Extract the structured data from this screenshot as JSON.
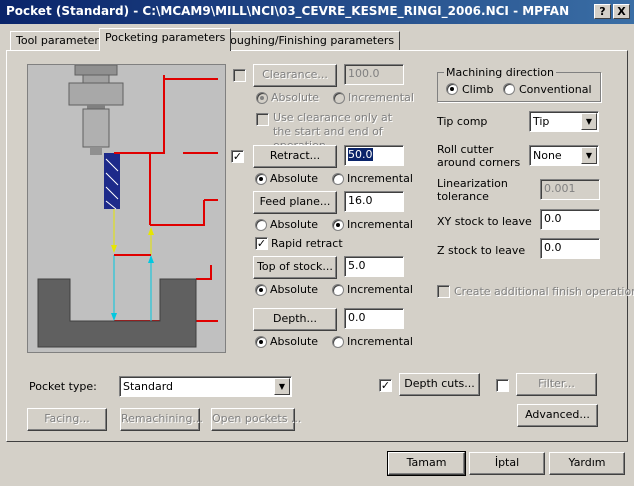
{
  "window": {
    "title": "Pocket (Standard) - C:\\MCAM9\\MILL\\NCI\\03_CEVRE_KESME_RINGI_2006.NCI - MPFAN",
    "help_btn": "?",
    "close_btn": "X"
  },
  "tabs": [
    {
      "label": "Tool parameters"
    },
    {
      "label": "Pocketing parameters"
    },
    {
      "label": "Roughing/Finishing parameters"
    }
  ],
  "clearance": {
    "label": "Clearance...",
    "value": "100.0",
    "note": "Use clearance only at the start and end of operation"
  },
  "retract": {
    "label": "Retract...",
    "value": "50.0"
  },
  "feed_plane": {
    "label": "Feed plane...",
    "value": "16.0"
  },
  "rapid_retract": "Rapid retract",
  "top_of_stock": {
    "label": "Top of stock...",
    "value": "5.0"
  },
  "depth": {
    "label": "Depth...",
    "value": "0.0"
  },
  "absolute": "Absolute",
  "incremental": "Incremental",
  "machining_direction": {
    "title": "Machining direction",
    "climb": "Climb",
    "conventional": "Conventional"
  },
  "tip_comp": {
    "label": "Tip comp",
    "value": "Tip"
  },
  "roll_cutter": {
    "label_1": "Roll cutter",
    "label_2": "around corners",
    "value": "None"
  },
  "linearization": {
    "label_1": "Linearization",
    "label_2": "tolerance",
    "value": "0.001"
  },
  "xy_stock": {
    "label": "XY stock to leave",
    "value": "0.0"
  },
  "z_stock": {
    "label": "Z stock to leave",
    "value": "0.0"
  },
  "finish_op": "Create additional finish operation",
  "pocket_type": {
    "label": "Pocket type:",
    "value": "Standard"
  },
  "depth_cuts": "Depth cuts...",
  "filter": "Filter...",
  "facing": "Facing...",
  "remachining": "Remachining...",
  "open_pockets": "Open pockets ...",
  "advanced": "Advanced...",
  "footer": {
    "ok": "Tamam",
    "cancel": "İptal",
    "help": "Yardım"
  }
}
